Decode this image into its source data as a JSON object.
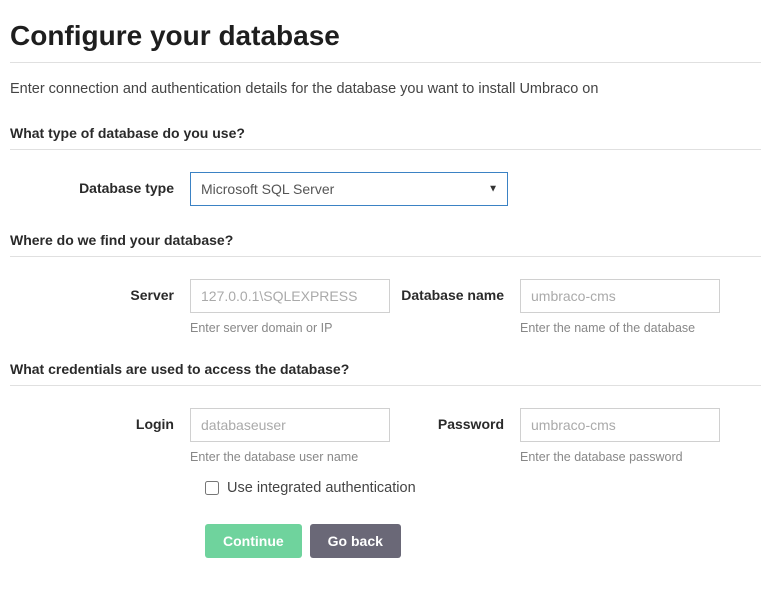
{
  "page": {
    "title": "Configure your database",
    "intro": "Enter connection and authentication details for the database you want to install Umbraco on"
  },
  "sections": {
    "type": {
      "heading": "What type of database do you use?",
      "label": "Database type",
      "selected": "Microsoft SQL Server"
    },
    "location": {
      "heading": "Where do we find your database?",
      "server": {
        "label": "Server",
        "placeholder": "127.0.0.1\\SQLEXPRESS",
        "value": "",
        "help": "Enter server domain or IP"
      },
      "dbname": {
        "label": "Database name",
        "placeholder": "umbraco-cms",
        "value": "",
        "help": "Enter the name of the database"
      }
    },
    "credentials": {
      "heading": "What credentials are used to access the database?",
      "login": {
        "label": "Login",
        "placeholder": "databaseuser",
        "value": "",
        "help": "Enter the database user name"
      },
      "password": {
        "label": "Password",
        "placeholder": "umbraco-cms",
        "value": "",
        "help": "Enter the database password"
      },
      "integrated": {
        "label": "Use integrated authentication",
        "checked": false
      }
    }
  },
  "buttons": {
    "continue": "Continue",
    "goback": "Go back"
  }
}
